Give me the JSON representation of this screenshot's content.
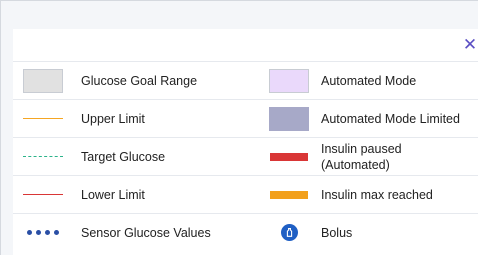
{
  "close": {
    "glyph": "✕"
  },
  "colors": {
    "goal_range": "#e1e1e1",
    "upper_limit": "#f5a623",
    "target_glucose": "#2bb38a",
    "lower_limit": "#d93636",
    "sensor_values": "#2a4fa5",
    "automated_mode": "#ead9fb",
    "automated_limited": "#a7a9c8",
    "insulin_paused": "#d93636",
    "insulin_max": "#f2a01c",
    "bolus": "#1f5fc4"
  },
  "legend": {
    "left": [
      {
        "label": "Glucose Goal Range",
        "icon": "swatch-box"
      },
      {
        "label": "Upper Limit",
        "icon": "solid-line"
      },
      {
        "label": "Target Glucose",
        "icon": "dashed-line"
      },
      {
        "label": "Lower Limit",
        "icon": "solid-line"
      },
      {
        "label": "Sensor Glucose Values",
        "icon": "dots"
      }
    ],
    "right": [
      {
        "label": "Automated Mode",
        "icon": "swatch-box"
      },
      {
        "label": "Automated Mode Limited",
        "icon": "swatch-box"
      },
      {
        "label": "Insulin paused (Automated)",
        "icon": "bar"
      },
      {
        "label": "Insulin max reached",
        "icon": "bar"
      },
      {
        "label": "Bolus",
        "icon": "bolus-icon"
      }
    ]
  }
}
